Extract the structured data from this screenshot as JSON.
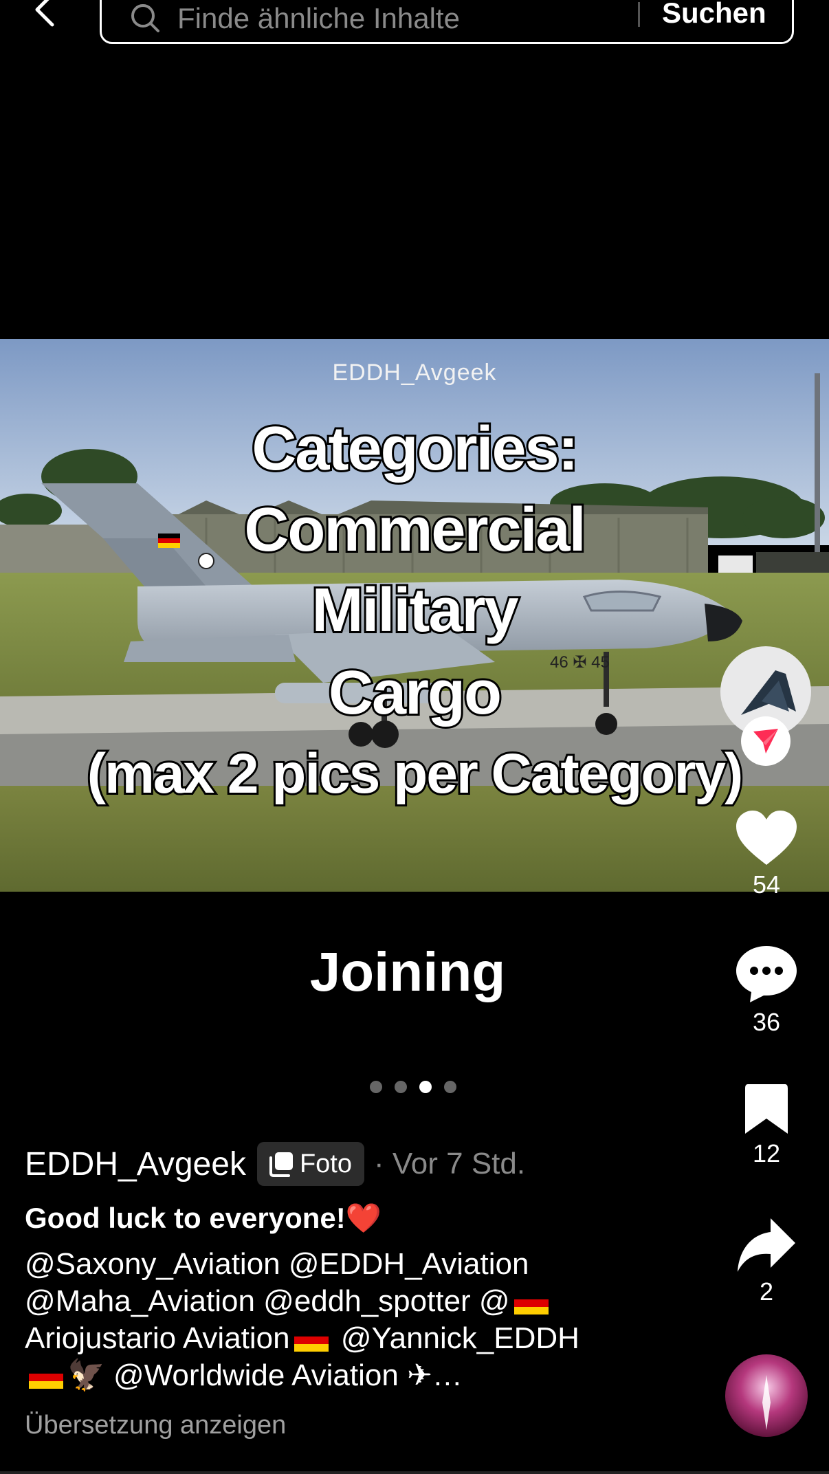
{
  "search": {
    "placeholder": "Finde ähnliche Inhalte",
    "submit_label": "Suchen"
  },
  "photo": {
    "watermark": "EDDH_Avgeek",
    "aircraft_marking": "46 ✠ 45",
    "overlay_lines": [
      "Categories:",
      "Commercial",
      "Military",
      "Cargo",
      "(max 2 pics per Category)"
    ]
  },
  "actions": {
    "likes": "54",
    "comments": "36",
    "bookmarks": "12",
    "shares": "2"
  },
  "post": {
    "heading": "Joining",
    "carousel": {
      "total": 4,
      "active_index": 2
    },
    "username": "EDDH_Avgeek",
    "type_badge": "Foto",
    "time_ago": "· Vor 7 Std.",
    "caption_title": "Good luck to everyone!",
    "caption_emoji": "❤️",
    "caption_lines": {
      "line1": "@Saxony_Aviation @EDDH_Aviation",
      "line2a": "@Maha_Aviation @eddh_spotter @",
      "line3a": "Ariojustario Aviation",
      "line3b": " @Yannick_EDDH",
      "line4a": "🦅",
      "line4b": " @Worldwide Aviation ✈…"
    },
    "translate_label": "Übersetzung anzeigen"
  },
  "colors": {
    "background": "#000000",
    "accent_red": "#fe2c55",
    "muted_text": "#8a8a8a",
    "flag_black": "#000000",
    "flag_red": "#dd0000",
    "flag_gold": "#ffce00"
  },
  "icons": {
    "back": "chevron-left-icon",
    "search": "search-icon",
    "like": "heart-icon",
    "comment": "comment-bubble-icon",
    "bookmark": "bookmark-icon",
    "share": "share-arrow-icon",
    "follow": "follow-plus-icon",
    "photo_badge": "photo-stack-icon"
  }
}
